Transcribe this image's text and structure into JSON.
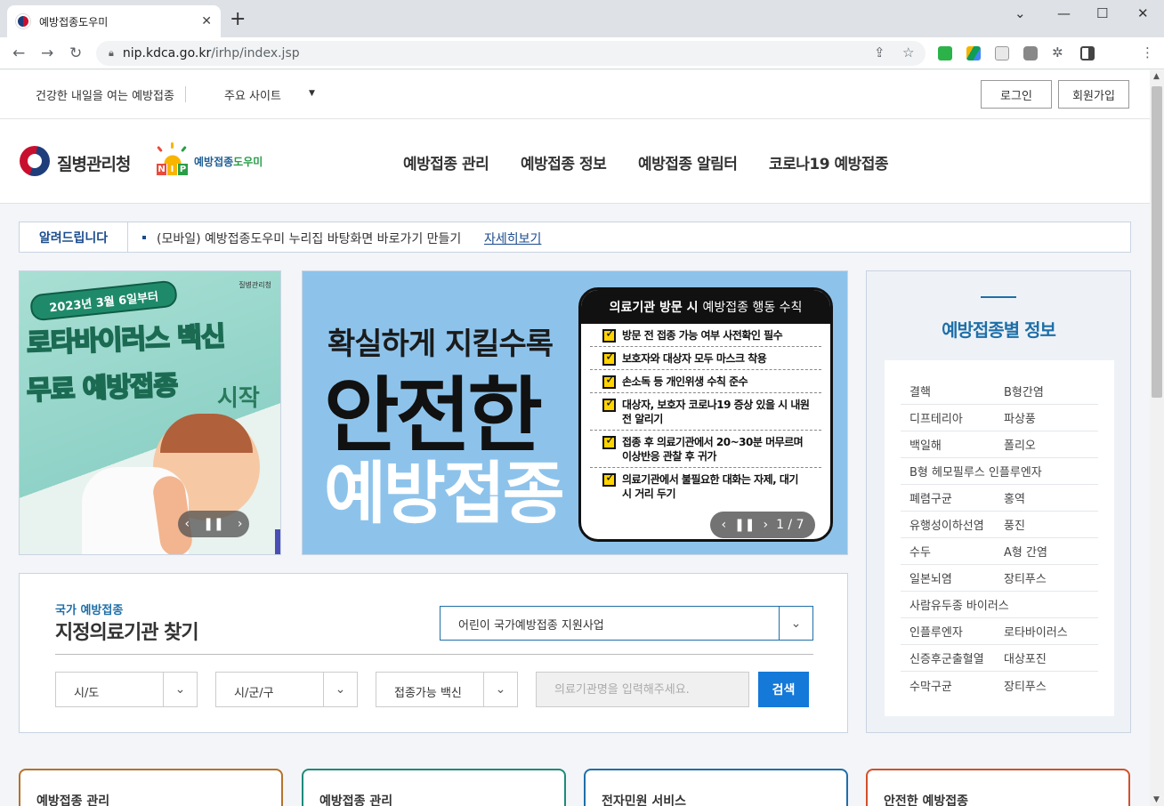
{
  "browser": {
    "tab_title": "예방접종도우미",
    "tab_close": "✕",
    "new_tab": "+",
    "url_host": "nip.kdca.go.kr",
    "url_path": "/irhp/index.jsp",
    "window_controls": [
      "⌄",
      "—",
      "☐",
      "✕"
    ]
  },
  "utility": {
    "slogan": "건강한 내일을 여는 예방접종",
    "sites_label": "주요 사이트",
    "login": "로그인",
    "signup": "회원가입"
  },
  "header": {
    "agency_name": "질병관리청",
    "nip_brand_blue": "예방접종",
    "nip_brand_green": "도우미",
    "nip_letters": [
      "N",
      "I",
      "P"
    ],
    "nav": [
      "예방접종 관리",
      "예방접종 정보",
      "예방접종 알림터",
      "코로나19 예방접종"
    ]
  },
  "notice": {
    "label": "알려드립니다",
    "text": "(모바일) 예방접종도우미 누리집 바탕화면 바로가기 만들기",
    "link": "자세히보기"
  },
  "banner_left": {
    "date": "2023년 3월 6일부터",
    "agency": "질병관리청",
    "title1": "로타바이러스 백신",
    "title2": "무료 예방접종",
    "title3": "시작"
  },
  "banner_center": {
    "line1": "확실하게 지킬수록",
    "line2": "안전한",
    "line3": "예방접종",
    "card_title_bold": "의료기관 방문 시",
    "card_title_rest": "예방접종 행동 수칙",
    "items": [
      "방문 전 접종 가능 여부 사전확인 필수",
      "보호자와 대상자 모두 마스크 착용",
      "손소독 등 개인위생 수칙 준수",
      "대상자, 보호자 코로나19 증상 있을 시 내원 전 알리기",
      "접종 후 의료기관에서 20~30분 머무르며 이상반응 관찰 후 귀가",
      "의료기관에서 불필요한 대화는 자제, 대기 시 거리 두기"
    ],
    "counter": "1 / 7"
  },
  "right_panel": {
    "title": "예방접종별 정보",
    "rows": [
      [
        "결핵",
        "B형간염"
      ],
      [
        "디프테리아",
        "파상풍"
      ],
      [
        "백일해",
        "폴리오"
      ],
      [
        "B형 헤모필루스 인플루엔자",
        ""
      ],
      [
        "폐렴구균",
        "홍역"
      ],
      [
        "유행성이하선염",
        "풍진"
      ],
      [
        "수두",
        "A형 간염"
      ],
      [
        "일본뇌염",
        "장티푸스"
      ],
      [
        "사람유두종 바이러스",
        ""
      ],
      [
        "인플루엔자",
        "로타바이러스"
      ],
      [
        "신증후군출혈열",
        "대상포진"
      ],
      [
        "수막구균",
        "장티푸스"
      ]
    ]
  },
  "search": {
    "subtitle": "국가 예방접종",
    "title": "지정의료기관 찾기",
    "program": "어린이 국가예방접종 지원사업",
    "sido": "시/도",
    "sigungu": "시/군/구",
    "vaccine": "접종가능 백신",
    "placeholder": "의료기관명을 입력해주세요.",
    "button": "검색"
  },
  "bottom_cards": [
    "예방접종 관리",
    "예방접종 관리",
    "전자민원 서비스",
    "안전한 예방접종"
  ],
  "colors": {
    "accent": "#1e6fa8",
    "button_blue": "#1479d8",
    "banner_center_bg": "#8dc3eb",
    "banner_left_bg": "#9ed8cf",
    "card_borders": [
      "#b5722a",
      "#1e8a7a",
      "#1e6fa8",
      "#d2502a"
    ]
  }
}
